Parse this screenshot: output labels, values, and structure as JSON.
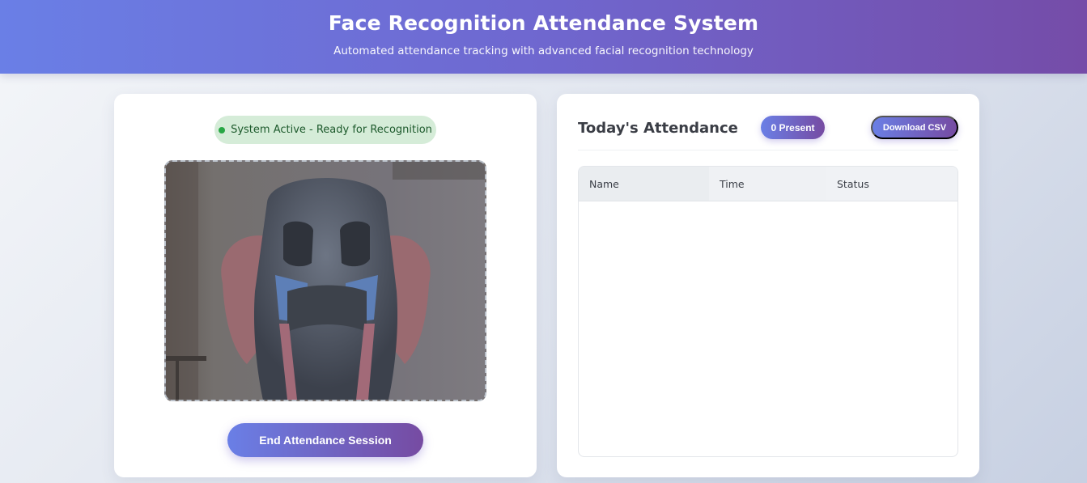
{
  "header": {
    "title": "Face Recognition Attendance System",
    "subtitle": "Automated attendance tracking with advanced facial recognition technology"
  },
  "camera_panel": {
    "status_text": "System Active - Ready for Recognition",
    "status_color": "#28a745",
    "end_button_label": "End Attendance Session"
  },
  "attendance_panel": {
    "title": "Today's Attendance",
    "present_badge": "0 Present",
    "download_label": "Download CSV",
    "table": {
      "columns": [
        "Name",
        "Time",
        "Status"
      ],
      "rows": []
    }
  },
  "colors": {
    "accent_start": "#667eea",
    "accent_end": "#764ba2",
    "status_bg": "#d4edda"
  }
}
